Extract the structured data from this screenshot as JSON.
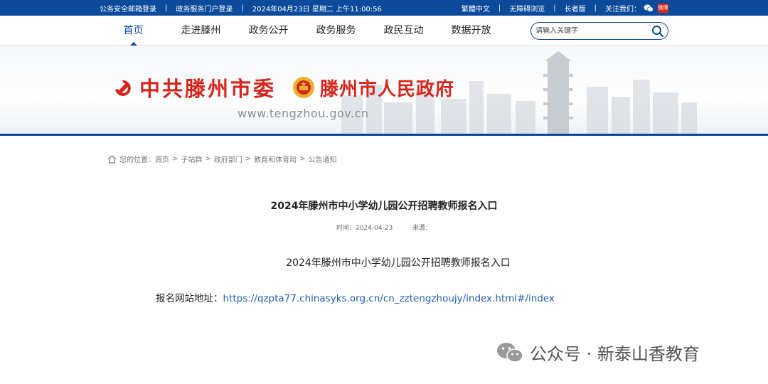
{
  "topbar": {
    "email_login": "公务安全邮箱登录",
    "portal_login": "政务服务门户登录",
    "datetime": "2024年04月23日 星期二 上午11:00:56",
    "traditional": "繁體中文",
    "accessible": "无障碍浏览",
    "elder": "长者版",
    "follow": "关注我们：",
    "weibo": "微博",
    "sep": "|"
  },
  "nav": {
    "items": [
      "首页",
      "走进滕州",
      "政务公开",
      "政务服务",
      "政民互动",
      "数据开放"
    ],
    "search_placeholder": "请输入关键字"
  },
  "banner": {
    "party_name": "中共滕州市委",
    "gov_name": "滕州市人民政府",
    "url": "www.tengzhou.gov.cn"
  },
  "breadcrumb": {
    "prefix": "您的位置：",
    "items": [
      "首页",
      "子站群",
      "政府部门",
      "教育和体育局",
      "公告通知"
    ],
    "sep": ">"
  },
  "article": {
    "title": "2024年滕州市中小学幼儿园公开招聘教师报名入口",
    "time_label": "时间：",
    "time_value": "2024-04-23",
    "source_label": "来源：",
    "body_title": "2024年滕州市中小学幼儿园公开招聘教师报名入口",
    "reg_label": "报名网站地址：",
    "reg_url": "https://qzpta77.chinasyks.org.cn/cn_zztengzhoujy/index.html#/index"
  },
  "watermark": {
    "text": "公众号 · 新泰山香教育"
  },
  "colors": {
    "brand_blue": "#0c4a9c",
    "party_red": "#d8251c",
    "link_blue": "#1f5fb0"
  }
}
